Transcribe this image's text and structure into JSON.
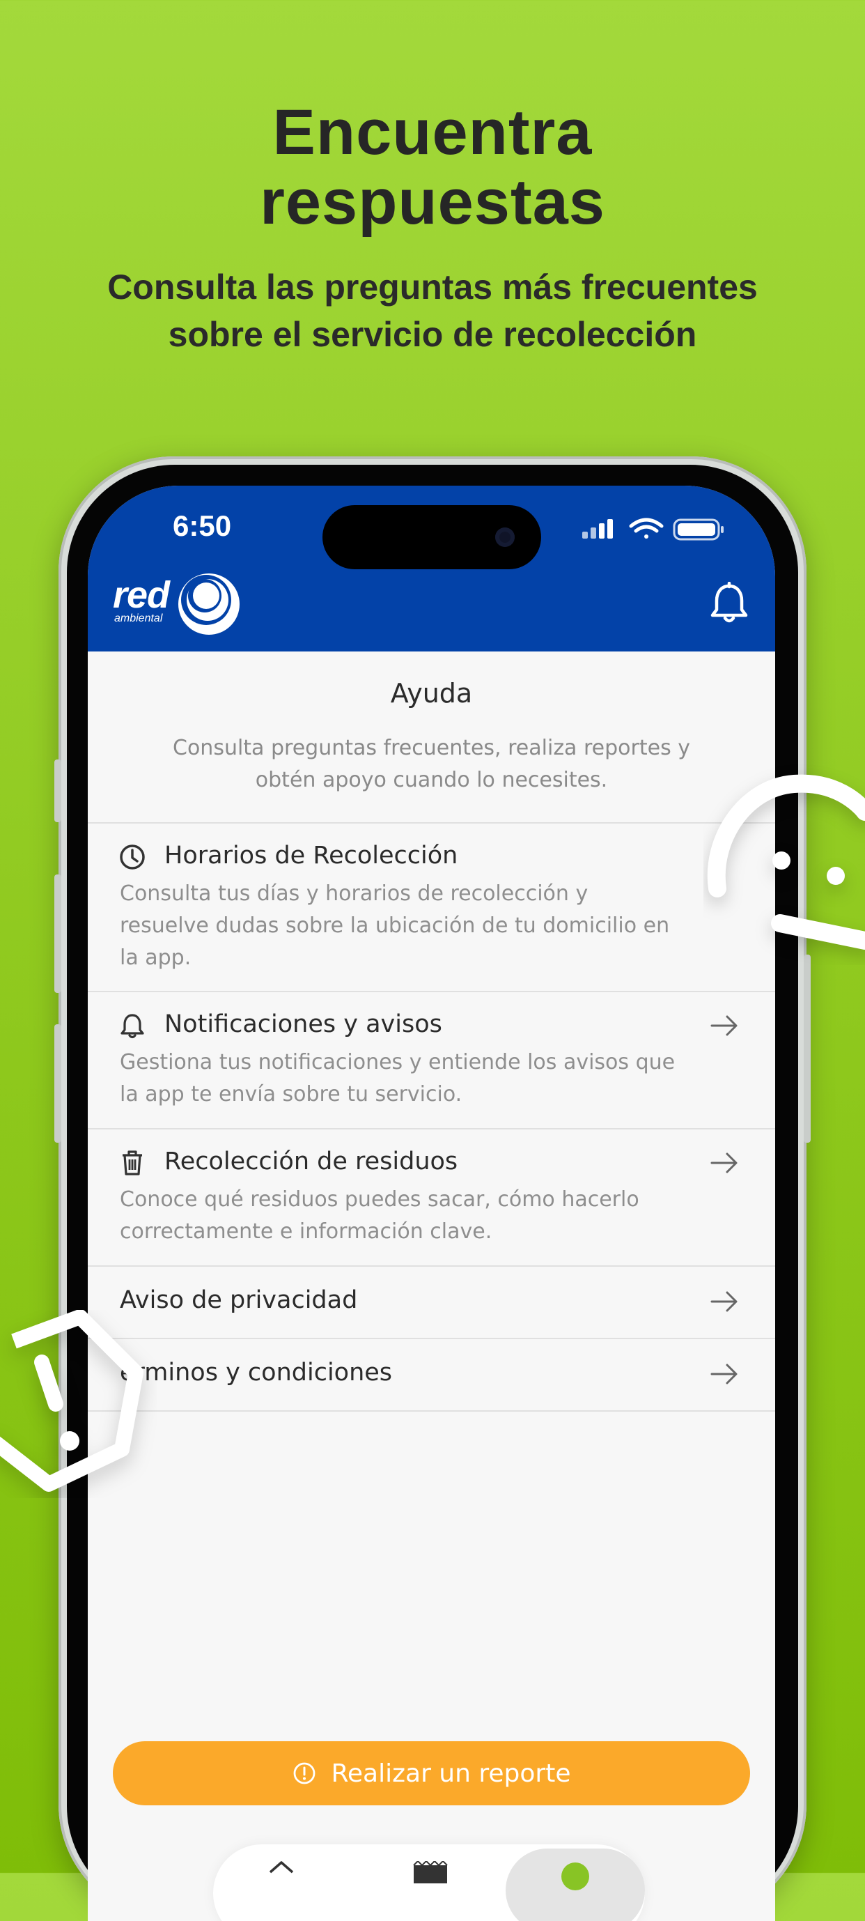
{
  "promo": {
    "title_line1": "Encuentra",
    "title_line2": "respuestas",
    "subtitle_line1": "Consulta las preguntas más frecuentes",
    "subtitle_line2": "sobre el servicio de recolección"
  },
  "status_bar": {
    "time": "6:50"
  },
  "app_header": {
    "logo_text": "red",
    "logo_subtext": "ambiental",
    "notification_icon": "bell-icon",
    "background_color": "#0342a8"
  },
  "help": {
    "title": "Ayuda",
    "description_line1": "Consulta preguntas frecuentes, realiza reportes y",
    "description_line2": "obtén apoyo cuando lo necesites."
  },
  "help_items": [
    {
      "icon": "clock-icon",
      "title": "Horarios de Recolección",
      "desc_line1": "Consulta tus días y horarios de recolección y",
      "desc_line2": "resuelve dudas sobre la ubicación de tu domicilio en",
      "desc_line3": "la app."
    },
    {
      "icon": "bell-icon",
      "title": "Notificaciones y avisos",
      "desc_line1": "Gestiona tus notificaciones y entiende los avisos que",
      "desc_line2": "la app te envía sobre tu servicio."
    },
    {
      "icon": "trash-icon",
      "title": "Recolección de residuos",
      "desc_line1": "Conoce qué residuos puedes sacar, cómo hacerlo",
      "desc_line2": "correctamente e información clave."
    },
    {
      "title": "Aviso de privacidad"
    },
    {
      "title": "érminos y condiciones"
    }
  ],
  "report_button": {
    "label": "Realizar un reporte",
    "icon": "alert-circle-icon",
    "color": "#fba92a"
  },
  "colors": {
    "background_green": "#92cb22",
    "accent_blue": "#0342a8",
    "accent_orange": "#fba92a"
  }
}
